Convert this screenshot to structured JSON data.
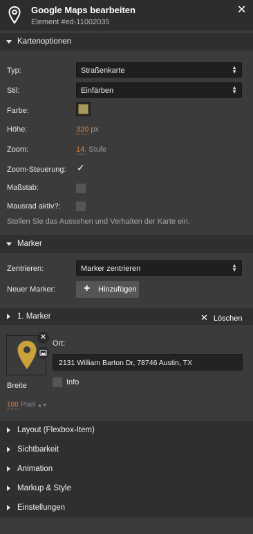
{
  "header": {
    "title": "Google Maps bearbeiten",
    "subtitle": "Element #ed-11002035",
    "close_label": "✕"
  },
  "kartenoptionen": {
    "section_label": "Kartenoptionen",
    "typ_label": "Typ:",
    "typ_value": "Straßenkarte",
    "stil_label": "Stil:",
    "stil_value": "Einfärben",
    "farbe_label": "Farbe:",
    "farbe_color": "#a89a5f",
    "hoehe_label": "Höhe:",
    "hoehe_value": "320",
    "hoehe_unit": "px",
    "zoom_label": "Zoom:",
    "zoom_value": "14.",
    "zoom_unit": "Stufe",
    "zoom_steuerung_label": "Zoom-Steuerung:",
    "zoom_steuerung_checked": true,
    "massstab_label": "Maßstab:",
    "massstab_checked": false,
    "mausrad_label": "Mausrad aktiv?:",
    "mausrad_checked": false,
    "hint": "Stellen Sie das Aussehen und Verhalten der Karte ein."
  },
  "marker": {
    "section_label": "Marker",
    "zentrieren_label": "Zentrieren:",
    "zentrieren_value": "Marker zentrieren",
    "neuer_marker_label": "Neuer Marker:",
    "add_button_label": "Hinzufügen"
  },
  "marker1": {
    "section_label": "1. Marker",
    "delete_label": "Löschen",
    "ort_label": "Ort:",
    "ort_value": "2131 William Barton Dr, 78746 Austin, TX",
    "info_label": "Info",
    "info_checked": false,
    "breite_label": "Breite",
    "breite_value": "100",
    "breite_unit": "Pixel",
    "marker_color": "#c9a23a"
  },
  "collapsed_sections": [
    "Layout (Flexbox-Item)",
    "Sichtbarkeit",
    "Animation",
    "Markup & Style",
    "Einstellungen"
  ],
  "colors": {
    "accent": "#e0803a",
    "header_bg": "#2d2d2d",
    "panel_bg": "#3b3b3b"
  }
}
